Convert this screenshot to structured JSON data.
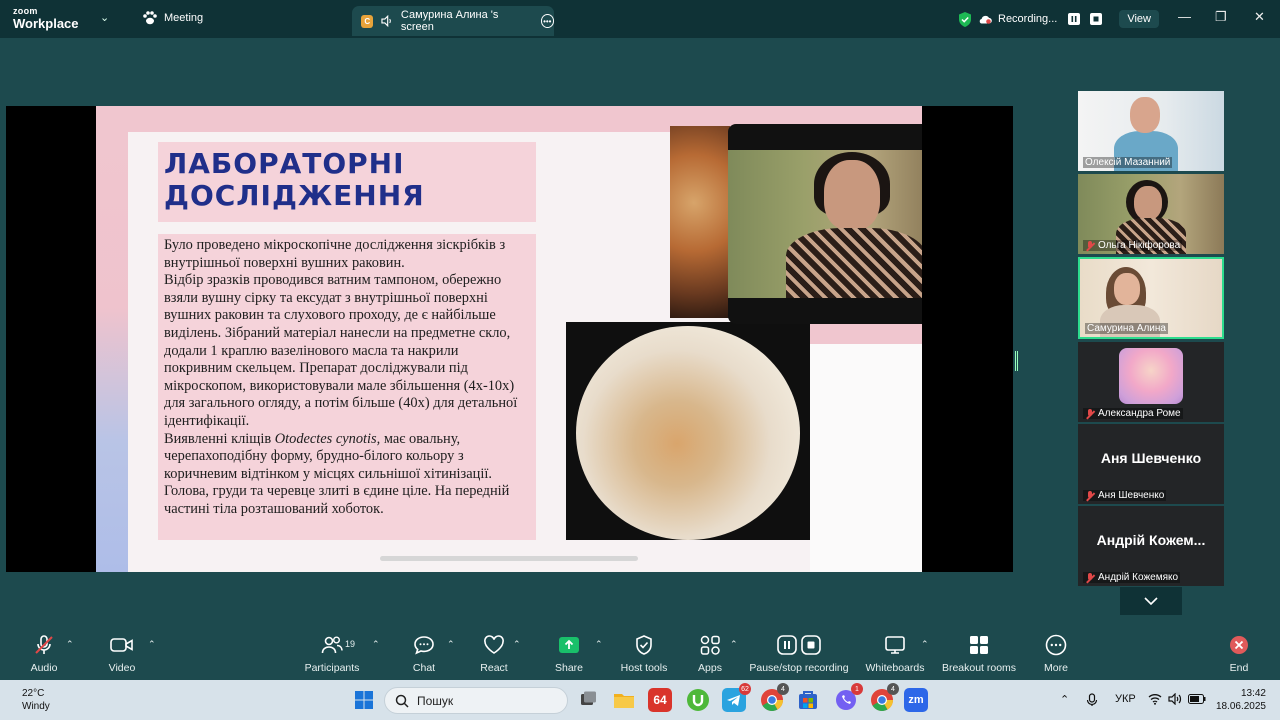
{
  "titlebar": {
    "brand_small": "zoom",
    "brand_large": "Workplace",
    "meeting_label": "Meeting",
    "share_tab_badge": "C",
    "share_tab_label": "Самурина Алина 's screen",
    "recording_label": "Recording...",
    "view_label": "View",
    "minimize_glyph": "—",
    "maximize_glyph": "❐",
    "close_glyph": "✕"
  },
  "slide": {
    "title_line1": "ЛАБОРАТОРНІ",
    "title_line2": "ДОСЛІДЖЕННЯ",
    "para1": "Було проведено мікроскопічне дослідження зіскрібків з внутрішньої поверхні вушних раковин.",
    "para2": "Відбір зразків проводився ватним тампоном, обережно взяли вушну сірку та ексудат з внутрішньої поверхні вушних раковин та слухового проходу, де є найбільше виділень. Зібраний матеріал нанесли на предметне скло, додали 1 краплю вазелінового масла та накрили покривним скельцем. Препарат досліджували під мікроскопом, використовували мале збільшення (4х-10х) для загального огляду, а потім більше (40х) для детальної ідентифікації.",
    "para3_prefix": "Виявленні кліщів ",
    "para3_species": "Otodectes cynotis,",
    "para3_rest": " має овальну, черепахоподібну форму, брудно-білого кольору з коричневим відтінком у місцях сильнішої хітинізації. Голова, груди та черевце злиті в єдине ціле. На передній частині тіла розташований хоботок."
  },
  "participants": [
    {
      "name": "Олексій Мазанний",
      "muted": false
    },
    {
      "name": "Ольга Нікіфорова",
      "muted": true
    },
    {
      "name": "Самурина Алина",
      "muted": false,
      "active": true
    },
    {
      "name": "Александра Роме",
      "muted": true
    },
    {
      "name": "Аня Шевченко",
      "big_name": "Аня Шевченко",
      "muted": true
    },
    {
      "name": "Андрій Кожемяко",
      "big_name": "Андрій Кожем...",
      "muted": true
    }
  ],
  "controls": {
    "audio": "Audio",
    "video": "Video",
    "participants": "Participants",
    "participants_count": "19",
    "chat": "Chat",
    "react": "React",
    "share": "Share",
    "host_tools": "Host tools",
    "apps": "Apps",
    "pause_stop_recording": "Pause/stop recording",
    "whiteboards": "Whiteboards",
    "breakout_rooms": "Breakout rooms",
    "more": "More",
    "end": "End"
  },
  "taskbar": {
    "temperature": "22°C",
    "weather": "Windy",
    "search_placeholder": "Пошук",
    "app_64_label": "64",
    "badge_telegram": "62",
    "badge_chrome1": "4",
    "badge_viber": "1",
    "badge_chrome2": "4",
    "zoom_label": "zm",
    "language": "УКР",
    "time": "13:42",
    "date": "18.06.2025"
  },
  "colors": {
    "meeting_bg": "#1d4a4e",
    "titlebar_bg": "#0f3236",
    "slide_title": "#202f8a",
    "slide_pink": "#f5d3da",
    "active_speaker": "#2ddc8e",
    "muted_red": "#e04848",
    "end_red": "#e05a5a"
  }
}
